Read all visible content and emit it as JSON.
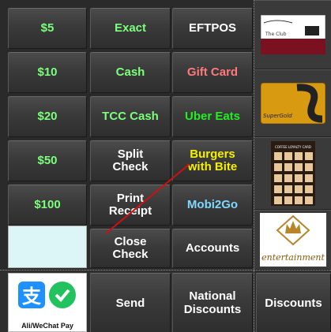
{
  "payment_grid": {
    "cash_amounts": [
      "$5",
      "$10",
      "$20",
      "$50",
      "$100"
    ],
    "middle": [
      "Exact",
      "Cash",
      "TCC Cash",
      "Split\nCheck",
      "Print\nReceipt",
      "Close\nCheck"
    ],
    "right": [
      "EFTPOS",
      "Gift Card",
      "Uber Eats",
      "Burgers\nwith Bite",
      "Mobi2Go",
      "Accounts"
    ]
  },
  "sidebar": {
    "tiles": [
      {
        "icon": "coffee-club-card-icon",
        "caption": "The Club"
      },
      {
        "icon": "supergold-card-icon",
        "caption": "SuperGold"
      },
      {
        "icon": "loyalty-stamp-card-icon",
        "caption": "COFFEE LOYALTY CARD"
      },
      {
        "icon": "entertainment-crown-icon",
        "caption": "entertainment"
      }
    ]
  },
  "bottom_bar": {
    "alipay_label": "Ali/WeChat Pay",
    "send": "Send",
    "national_discounts": "National\nDiscounts",
    "discounts": "Discounts"
  },
  "colors": {
    "green": "#7CFF7C",
    "salmon": "#FF7A7A",
    "bright_green": "#22EE22",
    "yellow": "#F5F000",
    "cyan": "#7FD8FF",
    "annotation_red": "#D01010"
  }
}
